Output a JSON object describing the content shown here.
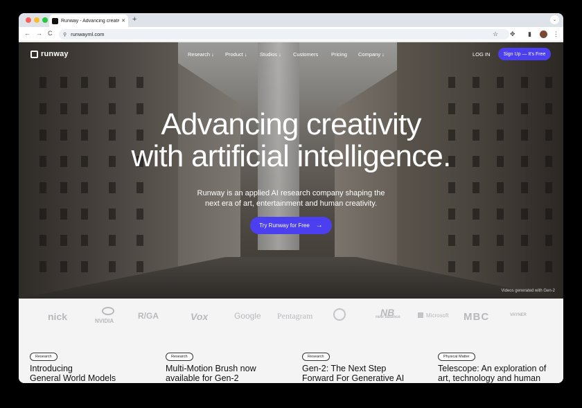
{
  "browser": {
    "tab_title": "Runway - Advancing creativi",
    "tab_close": "✕",
    "new_tab": "+",
    "tab_menu": "⌄",
    "url": "runwayml.com",
    "nav": {
      "back": "←",
      "forward": "→",
      "reload": "C"
    },
    "icons": {
      "star": "☆",
      "extensions": "✥",
      "sidebar": "▮",
      "more": "⋮",
      "site_info": "⚲"
    }
  },
  "site": {
    "logo": "runway",
    "menu": [
      "Research ↓",
      "Product ↓",
      "Studios ↓",
      "Customers",
      "Pricing",
      "Company ↓"
    ],
    "login": "LOG IN",
    "signup": "Sign Up — It's Free"
  },
  "hero": {
    "headline_line1": "Advancing creativity",
    "headline_line2": "with artificial intelligence.",
    "sub_line1": "Runway is an applied AI research company shaping the",
    "sub_line2": "next era of art, entertainment and human creativity.",
    "cta": "Try Runway for Free",
    "cta_arrow": "→",
    "caption": "Videos generated with Gen-2"
  },
  "partner_logos": [
    "nick",
    "NVIDIA",
    "R/GA",
    "Vox",
    "Google",
    "Pentagram",
    "",
    "new balance",
    "Microsoft",
    "MBC",
    "VAYNER"
  ],
  "cards": [
    {
      "tag": "Research",
      "title_line1": "Introducing",
      "title_line2": "General World Models"
    },
    {
      "tag": "Research",
      "title_line1": "Multi-Motion Brush now",
      "title_line2": "available for Gen-2"
    },
    {
      "tag": "Research",
      "title_line1": "Gen-2: The Next Step",
      "title_line2": "Forward For Generative AI"
    },
    {
      "tag": "Physical Matter",
      "title_line1": "Telescope: An exploration of",
      "title_line2": "art, technology and human"
    }
  ],
  "colors": {
    "accent": "#4b3ff0",
    "traffic_red": "#ff5f57",
    "traffic_yellow": "#febc2e",
    "traffic_green": "#28c840"
  }
}
